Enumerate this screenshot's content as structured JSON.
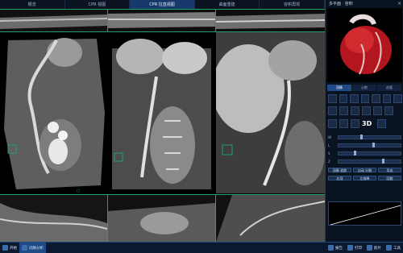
{
  "tabs": [
    {
      "label": "概览",
      "active": false
    },
    {
      "label": "CPR 视图",
      "active": false
    },
    {
      "label": "CPR 拉直视图",
      "active": true
    },
    {
      "label": "曲面重建",
      "active": false
    },
    {
      "label": "容积再现",
      "active": false
    }
  ],
  "panel": {
    "title": "多平面 · 容积",
    "close_glyph": "×",
    "tabs": [
      "冠脉",
      "心腔",
      "血管"
    ],
    "controls": [
      {
        "label": "W",
        "value": 0.35
      },
      {
        "label": "L",
        "value": 0.55
      },
      {
        "label": "S",
        "value": 0.25
      },
      {
        "label": "Z",
        "value": 0.7
      }
    ],
    "buttons": [
      "冠脉 追踪",
      "自动 分割",
      "导出"
    ],
    "sub_buttons": [
      "右冠",
      "左前降",
      "回旋"
    ],
    "threeD_label": "3D"
  },
  "taskbar": {
    "items": [
      {
        "label": "开始",
        "active": false
      },
      {
        "label": "冠脉分析",
        "active": true
      },
      {
        "label": "报告",
        "active": false
      },
      {
        "label": "打印",
        "active": false
      },
      {
        "label": "胶片",
        "active": false
      },
      {
        "label": "工具",
        "active": false
      }
    ]
  }
}
